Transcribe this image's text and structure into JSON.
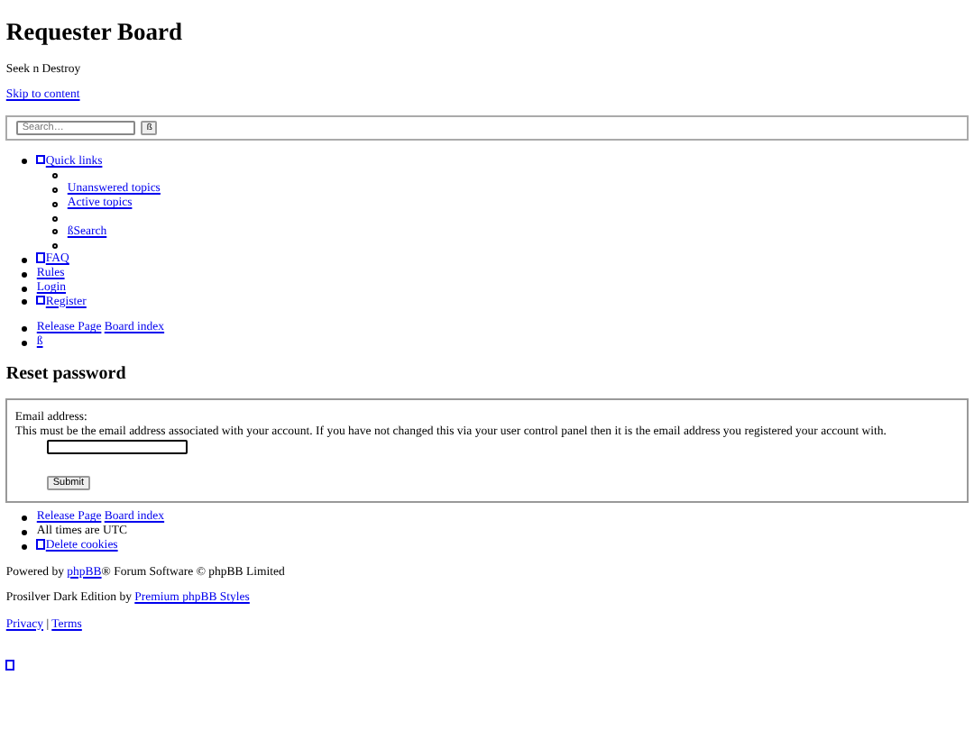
{
  "header": {
    "title": "Requester Board",
    "description": "Seek n Destroy",
    "skip_link": "Skip to content"
  },
  "search": {
    "placeholder": "Search…",
    "button": "ß"
  },
  "nav": [
    {
      "kind": "link",
      "icon": true,
      "label": "Quick links",
      "children": [
        {
          "kind": "empty"
        },
        {
          "kind": "link",
          "icon": false,
          "label": "Unanswered topics"
        },
        {
          "kind": "link",
          "icon": false,
          "label": "Active topics"
        },
        {
          "kind": "empty"
        },
        {
          "kind": "link",
          "icon": false,
          "label": "ßSearch"
        },
        {
          "kind": "empty"
        }
      ]
    },
    {
      "kind": "link",
      "icon": true,
      "label": "FAQ"
    },
    {
      "kind": "link",
      "icon": false,
      "label": "Rules"
    },
    {
      "kind": "link",
      "icon": false,
      "label": "Login"
    },
    {
      "kind": "link",
      "icon": true,
      "label": "Register"
    }
  ],
  "breadcrumbs": [
    {
      "links": [
        "Release Page",
        "Board index"
      ]
    },
    {
      "links": [
        "ß"
      ]
    }
  ],
  "page_title": "Reset password",
  "form": {
    "label": "Email address:",
    "explain": "This must be the email address associated with your account. If you have not changed this via your user control panel then it is the email address you registered your account with.",
    "submit": "Submit"
  },
  "footer_list": [
    {
      "kind": "links",
      "icon": false,
      "links": [
        "Release Page",
        "Board index"
      ]
    },
    {
      "kind": "text",
      "text": "All times are UTC"
    },
    {
      "kind": "links",
      "icon": true,
      "links": [
        "Delete cookies"
      ]
    }
  ],
  "powered": {
    "before": "Powered by ",
    "link": "phpBB",
    "after": "® Forum Software © phpBB Limited"
  },
  "style_credit": {
    "before": "Prosilver Dark Edition by ",
    "link": "Premium phpBB Styles"
  },
  "legal": {
    "links": [
      "Privacy",
      "Terms"
    ],
    "separator": "|"
  },
  "bottom_icon_link": true
}
